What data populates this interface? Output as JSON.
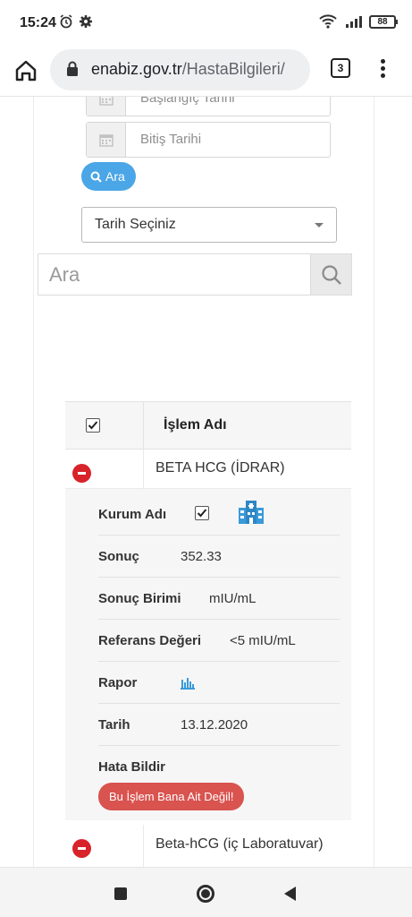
{
  "status_bar": {
    "time": "15:24",
    "battery": "88"
  },
  "browser": {
    "url_domain": "enabiz.gov.tr",
    "url_path": "/HastaBilgileri/",
    "tab_count": "3"
  },
  "filters": {
    "start_date_placeholder": "Başlangıç Tarihi",
    "end_date_placeholder": "Bitiş Tarihi",
    "search_button": "Ara",
    "date_select": "Tarih Seçiniz",
    "search_placeholder": "Ara"
  },
  "table": {
    "header": "İşlem Adı",
    "rows": [
      {
        "name": "BETA HCG (İDRAR)",
        "details": {
          "kurum_label": "Kurum Adı",
          "sonuc_label": "Sonuç",
          "sonuc": "352.33",
          "birim_label": "Sonuç Birimi",
          "birim": "mIU/mL",
          "referans_label": "Referans Değeri",
          "referans": "<5 mIU/mL",
          "rapor_label": "Rapor",
          "tarih_label": "Tarih",
          "tarih": "13.12.2020",
          "hata_label": "Hata Bildir",
          "hata_button": "Bu İşlem Bana Ait Değil!"
        }
      },
      {
        "name": "Beta-hCG (iç Laboratuvar)"
      }
    ]
  },
  "colors": {
    "accent_blue": "#4aa6e6",
    "danger_red": "#d9534f",
    "minus_red": "#d8232a"
  }
}
